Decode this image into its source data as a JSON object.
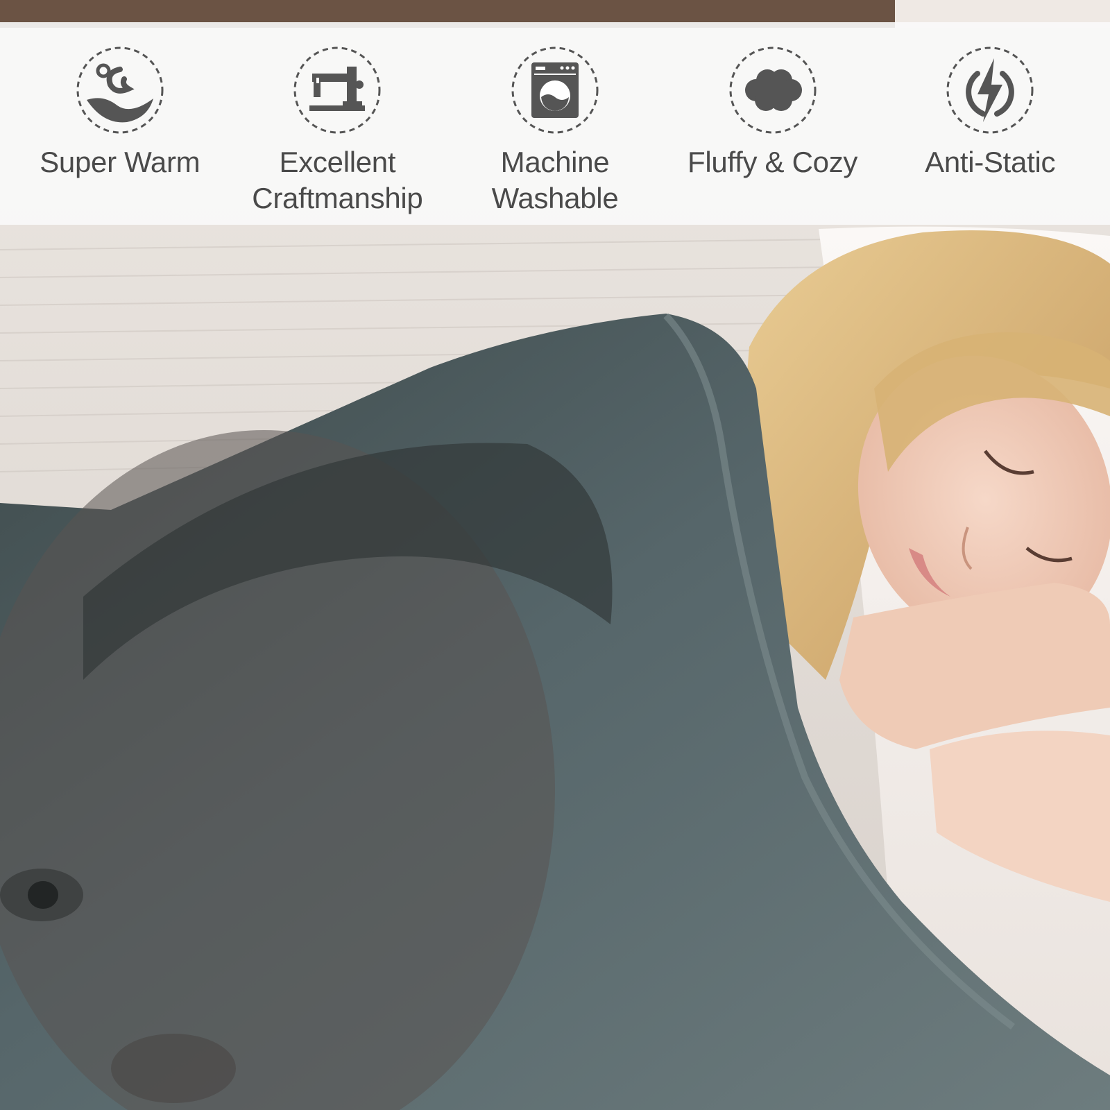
{
  "features": [
    {
      "icon": "warm-wave-icon",
      "label": "Super Warm"
    },
    {
      "icon": "sewing-machine-icon",
      "label": "Excellent\nCraftmanship"
    },
    {
      "icon": "washing-machine-icon",
      "label": "Machine\nWashable"
    },
    {
      "icon": "cloud-icon",
      "label": "Fluffy & Cozy"
    },
    {
      "icon": "lightning-bolt-icon",
      "label": "Anti-Static"
    }
  ],
  "colors": {
    "icon": "#555555",
    "label": "#4a4a4a",
    "blanket": "#5f6f70",
    "hair": "#d9b57a",
    "skin": "#f0cdb8",
    "pillow": "#f4efec"
  }
}
